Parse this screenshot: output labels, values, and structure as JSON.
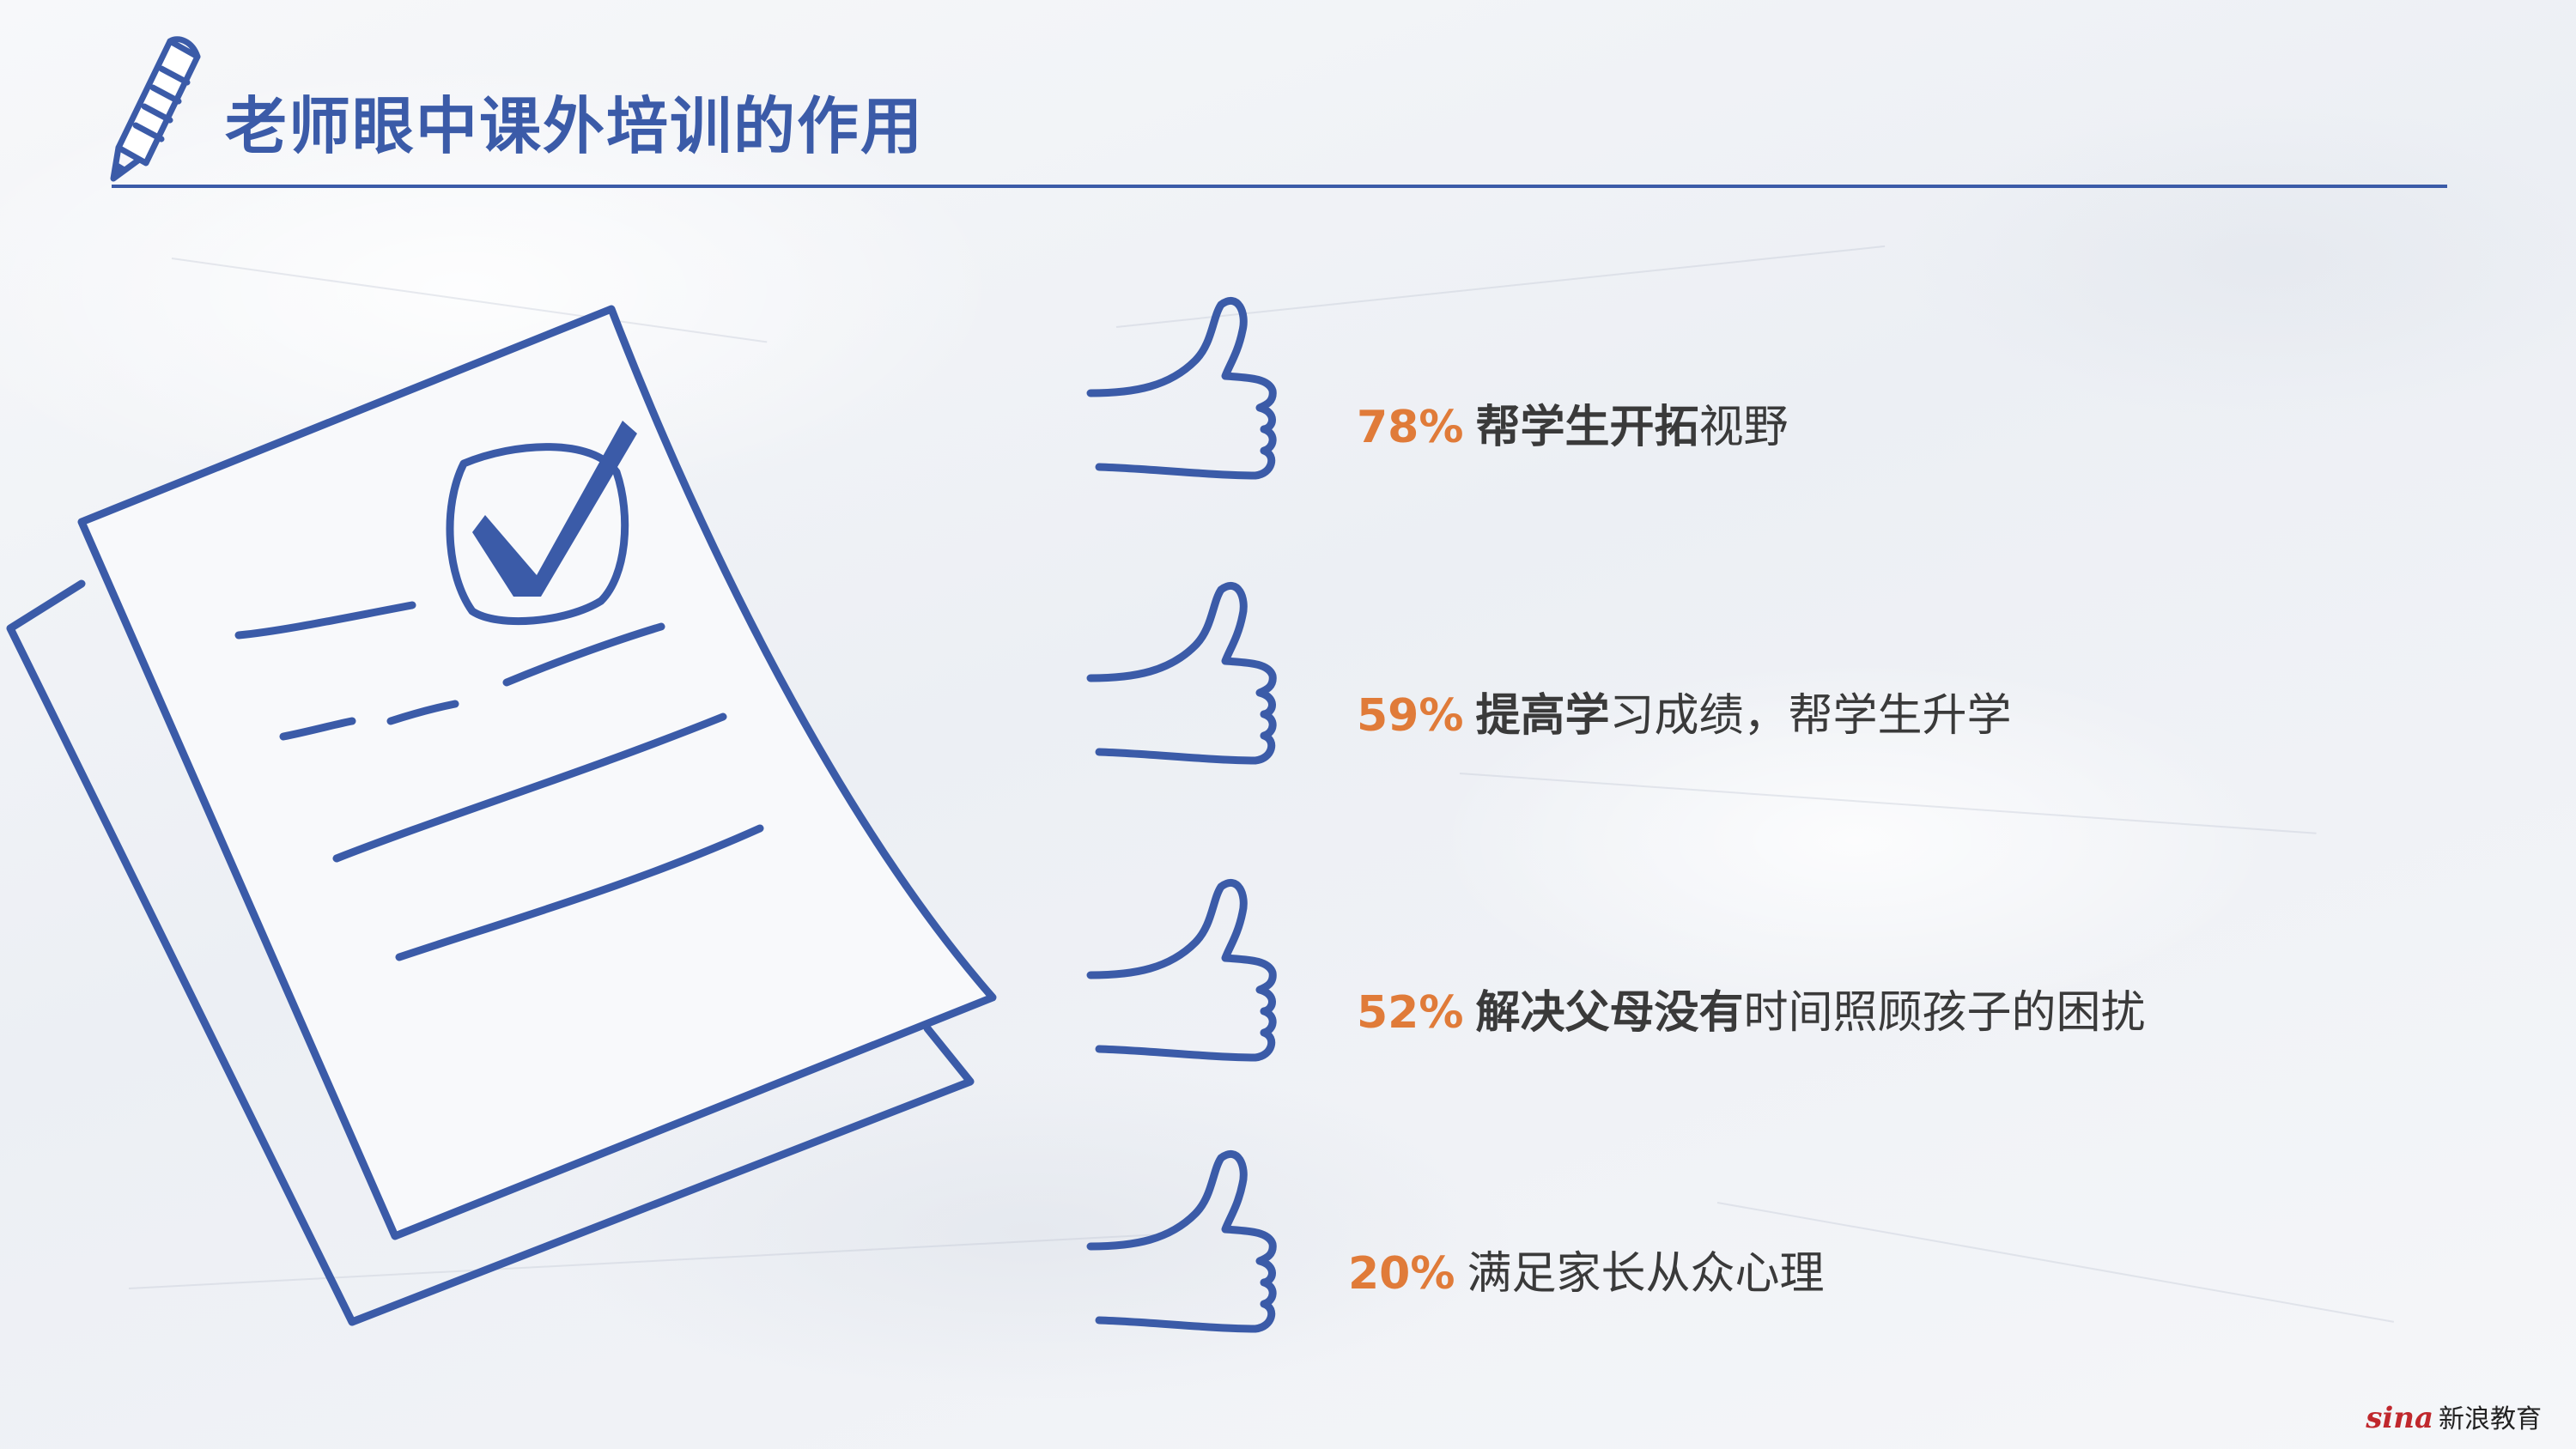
{
  "header": {
    "title": "老师眼中课外培训的作用"
  },
  "colors": {
    "accent_blue": "#3b5ba8",
    "percent_orange": "#e07b39",
    "text_dark": "#3a3a3a"
  },
  "items": [
    {
      "percent": "78%",
      "bold_text": "帮学生开拓",
      "normal_text": "视野"
    },
    {
      "percent": "59%",
      "bold_text": "提高学",
      "normal_text": "习成绩，帮学生升学"
    },
    {
      "percent": "52%",
      "bold_text": "解决父母没有",
      "normal_text": "时间照顾孩子的困扰"
    },
    {
      "percent": "20%",
      "bold_text": "",
      "normal_text": "满足家长从众心理"
    }
  ],
  "icons": {
    "header": "pencil-icon",
    "illustration": "document-checkmark-illustration",
    "bullet": "thumbs-up-icon"
  },
  "watermark": {
    "logo": "sina",
    "text": "新浪教育"
  }
}
